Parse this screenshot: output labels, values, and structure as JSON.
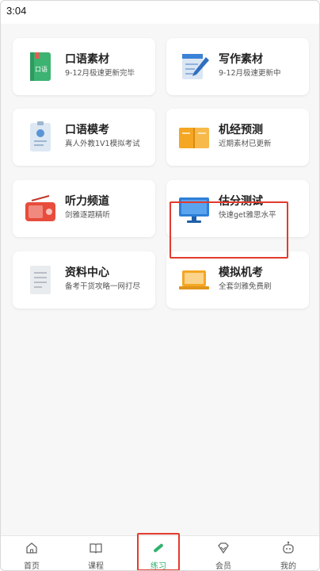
{
  "status_bar": {
    "time": "3:04"
  },
  "cards": [
    {
      "title": "口语素材",
      "subtitle": "9-12月极速更新完毕",
      "icon": "book-icon"
    },
    {
      "title": "写作素材",
      "subtitle": "9-12月极速更新中",
      "icon": "notepad-pen-icon"
    },
    {
      "title": "口语模考",
      "subtitle": "真人外教1V1模拟考试",
      "icon": "id-card-icon"
    },
    {
      "title": "机经预测",
      "subtitle": "近期素材已更新",
      "icon": "open-book-icon"
    },
    {
      "title": "听力频道",
      "subtitle": "剑雅逐题精听",
      "icon": "radio-icon"
    },
    {
      "title": "估分测试",
      "subtitle": "快速get雅思水平",
      "icon": "monitor-icon"
    },
    {
      "title": "资料中心",
      "subtitle": "备考干货攻略一网打尽",
      "icon": "document-icon"
    },
    {
      "title": "模拟机考",
      "subtitle": "全套剑雅免费刷",
      "icon": "laptop-icon"
    }
  ],
  "tabbar": [
    {
      "label": "首页",
      "icon": "home-icon"
    },
    {
      "label": "课程",
      "icon": "course-book-icon"
    },
    {
      "label": "练习",
      "icon": "pencil-icon",
      "active": true
    },
    {
      "label": "会员",
      "icon": "diamond-icon"
    },
    {
      "label": "我的",
      "icon": "robot-face-icon"
    }
  ],
  "colors": {
    "accent": "#2fb36e",
    "highlight": "#e23b2e"
  }
}
